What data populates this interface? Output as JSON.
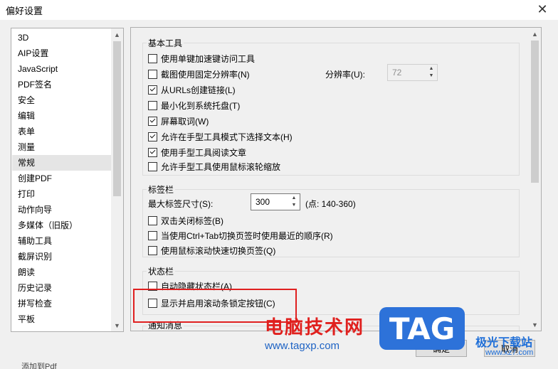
{
  "window": {
    "title": "偏好设置",
    "close_glyph": "✕"
  },
  "categories": [
    {
      "label": "3D"
    },
    {
      "label": "AIP设置"
    },
    {
      "label": "JavaScript"
    },
    {
      "label": "PDF签名"
    },
    {
      "label": "安全"
    },
    {
      "label": "编辑"
    },
    {
      "label": "表单"
    },
    {
      "label": "测量"
    },
    {
      "label": "常规",
      "selected": true
    },
    {
      "label": "创建PDF"
    },
    {
      "label": "打印"
    },
    {
      "label": "动作向导"
    },
    {
      "label": "多媒体（旧版）"
    },
    {
      "label": "辅助工具"
    },
    {
      "label": "截屏识别"
    },
    {
      "label": "朗读"
    },
    {
      "label": "历史记录"
    },
    {
      "label": "拼写检查"
    },
    {
      "label": "平板"
    }
  ],
  "basic_tools": {
    "title": "基本工具",
    "options": [
      {
        "label": "使用单键加速键访问工具",
        "checked": false
      },
      {
        "label": "截图使用固定分辨率(N)",
        "checked": false
      },
      {
        "label": "从URLs创建链接(L)",
        "checked": true
      },
      {
        "label": "最小化到系统托盘(T)",
        "checked": false
      },
      {
        "label": "屏幕取词(W)",
        "checked": true
      },
      {
        "label": "允许在手型工具模式下选择文本(H)",
        "checked": true
      },
      {
        "label": "使用手型工具阅读文章",
        "checked": true
      },
      {
        "label": "允许手型工具使用鼠标滚轮缩放",
        "checked": false
      }
    ],
    "resolution": {
      "label": "分辨率(U):",
      "value": "72"
    }
  },
  "tab_bar": {
    "title": "标签栏",
    "max_width": {
      "label": "最大标签尺寸(S):",
      "value": "300",
      "hint": "(点: 140-360)"
    },
    "options": [
      {
        "label": "双击关闭标签(B)",
        "checked": false
      },
      {
        "label": "当使用Ctrl+Tab切换页签时使用最近的顺序(R)",
        "checked": false
      },
      {
        "label": "使用鼠标滚动快速切换页签(Q)",
        "checked": false
      }
    ]
  },
  "status_bar": {
    "title": "状态栏",
    "options": [
      {
        "label": "自动隐藏状态栏(A)",
        "checked": false
      },
      {
        "label": "显示并启用滚动条锁定按钮(C)",
        "checked": false
      }
    ]
  },
  "notifications": {
    "title": "通知消息"
  },
  "buttons": {
    "ok": "确定",
    "cancel": "取消"
  },
  "overlay": {
    "watermark_text": "电脑技术网",
    "watermark_url": "www.tagxp.com",
    "tag_logo": "TAG",
    "site_logo_title": "极光下载站",
    "site_logo_url": "www.xz7.com",
    "bottom_clip": "添加到Pdf"
  },
  "colors": {
    "highlight": "#e02020",
    "selected_bg": "#e5e5e5",
    "watermark_red": "#e0201e",
    "tag_blue": "#2d72d9"
  },
  "scroll": {
    "category_list_position": 0.0,
    "panel_position": 0.0
  }
}
